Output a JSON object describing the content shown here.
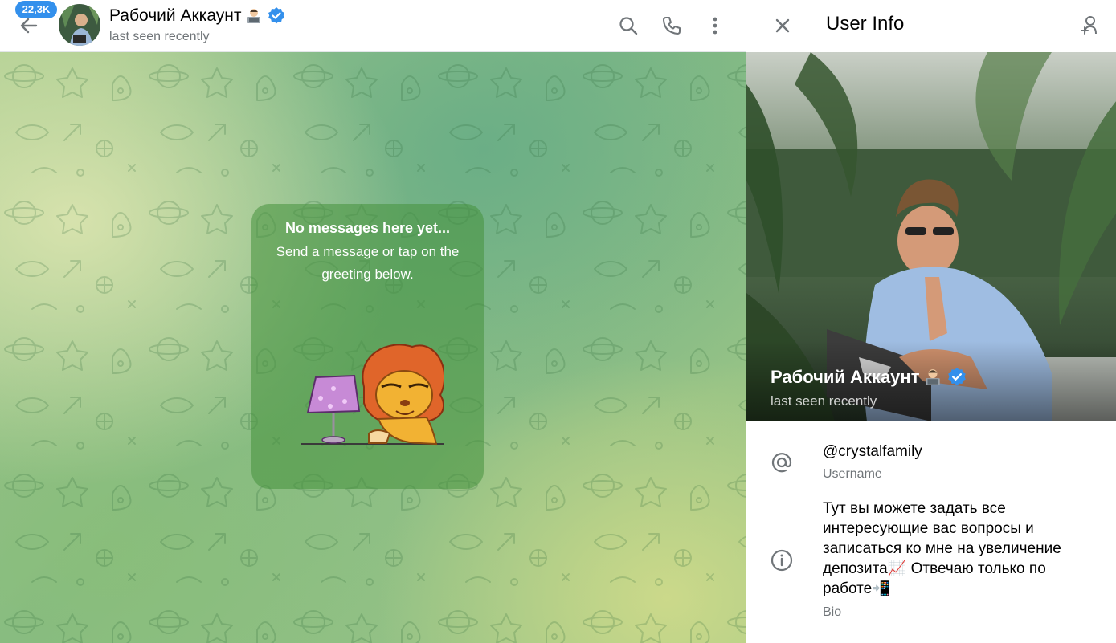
{
  "chat": {
    "back_label": "Back",
    "unread_count": "22,3K",
    "title": "Рабочий Аккаунт",
    "status": "last seen recently",
    "verified": true
  },
  "empty_state": {
    "title": "No messages here yet...",
    "text": "Send a message or tap on the greeting below."
  },
  "panel": {
    "title": "User Info",
    "name": "Рабочий Аккаунт",
    "status": "last seen recently",
    "username": "@crystalfamily",
    "username_label": "Username",
    "bio_lines": [
      "Тут вы можете задать все",
      "интересующие вас вопросы и",
      "записаться ко мне на увеличение",
      "депозита📈 Отвечаю только по",
      "работе📲"
    ],
    "bio_label": "Bio"
  },
  "icons": {
    "back": "arrow-left-icon",
    "search": "search-icon",
    "call": "phone-icon",
    "more": "more-vertical-icon",
    "close": "close-icon",
    "add_contact": "add-user-icon",
    "username": "at-icon",
    "bio": "info-icon",
    "verified": "verified-badge-icon"
  },
  "colors": {
    "accent": "#3390ec",
    "verified": "#3390ec",
    "secondary_text": "#707579",
    "empty_card": "rgba(70,145,60,0.55)"
  }
}
